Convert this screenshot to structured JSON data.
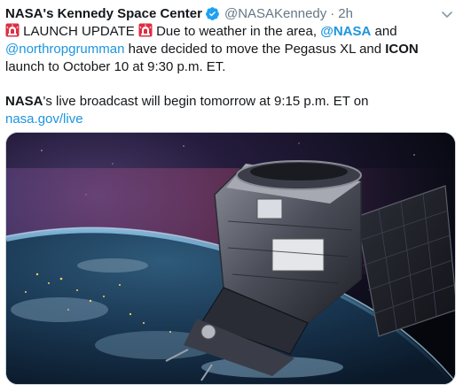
{
  "tweet": {
    "display_name": "NASA's Kennedy Space Center",
    "handle": "@NASAKennedy",
    "separator": "·",
    "timestamp": "2h",
    "line1": {
      "emoji1": "rotating-light",
      "pre": " LAUNCH UPDATE ",
      "emoji2": "rotating-light",
      "mid": " Due to weather in the area, ",
      "mention1": "@NASA",
      "post1": " and"
    },
    "line2": {
      "mention2": "@northropgrumman",
      "text": " have decided to move the Pegasus XL and ",
      "bold": "ICON"
    },
    "line3": {
      "text": "launch to October 10 at 9:30 p.m. ET."
    },
    "line4": {
      "bold": "NASA",
      "text": "'s live broadcast will begin tomorrow at 9:15 p.m. ET on"
    },
    "line5": {
      "link": "nasa.gov/live"
    }
  },
  "icons": {
    "verified": "verified-badge-icon",
    "caret": "chevron-down-icon",
    "siren": "police-siren-icon"
  },
  "colors": {
    "link": "#1b95e0",
    "muted": "#657786",
    "verified": "#1da1f2",
    "text": "#14171a"
  }
}
